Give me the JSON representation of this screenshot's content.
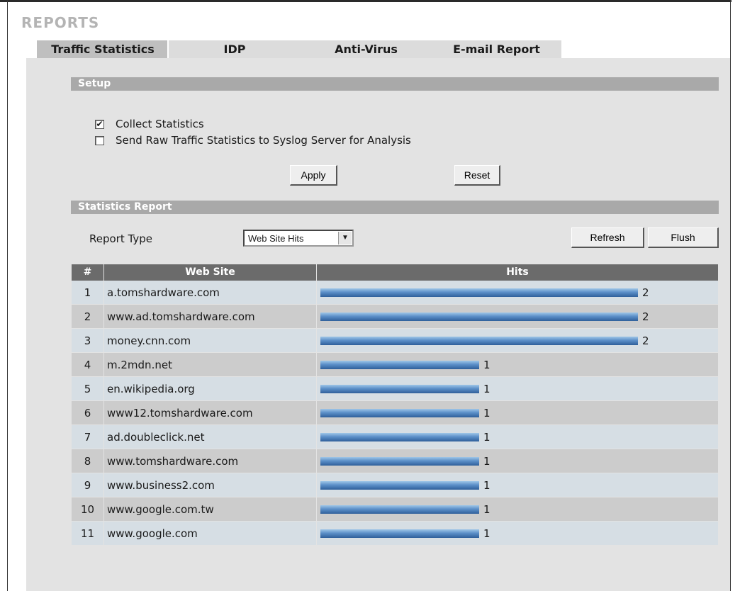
{
  "page": {
    "title": "REPORTS"
  },
  "tabs": [
    {
      "label": "Traffic Statistics",
      "active": true
    },
    {
      "label": "IDP",
      "active": false
    },
    {
      "label": "Anti-Virus",
      "active": false
    },
    {
      "label": "E-mail Report",
      "active": false
    }
  ],
  "setup": {
    "title": "Setup",
    "collect_label": "Collect Statistics",
    "collect_checked": true,
    "syslog_label": "Send Raw Traffic Statistics to Syslog Server for Analysis",
    "syslog_checked": false,
    "apply_label": "Apply",
    "reset_label": "Reset"
  },
  "report": {
    "title": "Statistics Report",
    "type_label": "Report Type",
    "type_value": "Web Site Hits",
    "refresh_label": "Refresh",
    "flush_label": "Flush",
    "max_hits": 2,
    "columns": [
      "#",
      "Web Site",
      "Hits"
    ],
    "rows": [
      {
        "num": "1",
        "site": "a.tomshardware.com",
        "hits": 2
      },
      {
        "num": "2",
        "site": "www.ad.tomshardware.com",
        "hits": 2
      },
      {
        "num": "3",
        "site": "money.cnn.com",
        "hits": 2
      },
      {
        "num": "4",
        "site": "m.2mdn.net",
        "hits": 1
      },
      {
        "num": "5",
        "site": "en.wikipedia.org",
        "hits": 1
      },
      {
        "num": "6",
        "site": "www12.tomshardware.com",
        "hits": 1
      },
      {
        "num": "7",
        "site": "ad.doubleclick.net",
        "hits": 1
      },
      {
        "num": "8",
        "site": "www.tomshardware.com",
        "hits": 1
      },
      {
        "num": "9",
        "site": "www.business2.com",
        "hits": 1
      },
      {
        "num": "10",
        "site": "www.google.com.tw",
        "hits": 1
      },
      {
        "num": "11",
        "site": "www.google.com",
        "hits": 1
      }
    ]
  }
}
